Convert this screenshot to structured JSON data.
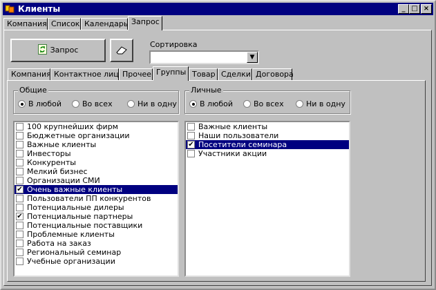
{
  "window": {
    "title": "Клиенты"
  },
  "main_tabs": [
    {
      "label": "Компания",
      "active": false
    },
    {
      "label": "Список",
      "active": false
    },
    {
      "label": "Календарь",
      "active": false
    },
    {
      "label": "Запрос",
      "active": true
    }
  ],
  "query": {
    "run_label": "Запрос",
    "sort_label": "Сортировка",
    "sort_value": ""
  },
  "sub_tabs": [
    {
      "label": "Компания",
      "active": false
    },
    {
      "label": "Контактное лицо",
      "active": false
    },
    {
      "label": "Прочее",
      "active": false
    },
    {
      "label": "Группы",
      "active": true
    },
    {
      "label": "Товар",
      "active": false
    },
    {
      "label": "Сделки",
      "active": false
    },
    {
      "label": "Договора",
      "active": false
    }
  ],
  "common": {
    "title": "Общие",
    "options": [
      "В любой",
      "Во всех",
      "Ни в одну"
    ],
    "selected": 0,
    "items": [
      {
        "label": "100 крупнейших фирм",
        "checked": false,
        "selected": false
      },
      {
        "label": "Бюджетные организации",
        "checked": false,
        "selected": false
      },
      {
        "label": "Важные клиенты",
        "checked": false,
        "selected": false
      },
      {
        "label": "Инвесторы",
        "checked": false,
        "selected": false
      },
      {
        "label": "Конкуренты",
        "checked": false,
        "selected": false
      },
      {
        "label": "Мелкий бизнес",
        "checked": false,
        "selected": false
      },
      {
        "label": "Организации СМИ",
        "checked": false,
        "selected": false
      },
      {
        "label": "Очень важные клиенты",
        "checked": true,
        "selected": true
      },
      {
        "label": "Пользователи ПП конкурентов",
        "checked": false,
        "selected": false
      },
      {
        "label": "Потенциальные дилеры",
        "checked": false,
        "selected": false
      },
      {
        "label": "Потенциальные партнеры",
        "checked": true,
        "selected": false
      },
      {
        "label": "Потенциальные поставщики",
        "checked": false,
        "selected": false
      },
      {
        "label": "Проблемные клиенты",
        "checked": false,
        "selected": false
      },
      {
        "label": "Работа на заказ",
        "checked": false,
        "selected": false
      },
      {
        "label": "Региональный семинар",
        "checked": false,
        "selected": false
      },
      {
        "label": "Учебные организации",
        "checked": false,
        "selected": false
      }
    ]
  },
  "personal": {
    "title": "Личные",
    "options": [
      "В любой",
      "Во всех",
      "Ни в одну"
    ],
    "selected": 0,
    "items": [
      {
        "label": "Важные клиенты",
        "checked": false,
        "selected": false
      },
      {
        "label": "Наши пользователи",
        "checked": false,
        "selected": false
      },
      {
        "label": "Посетители семинара",
        "checked": true,
        "selected": true
      },
      {
        "label": "Участники акции",
        "checked": false,
        "selected": false
      }
    ]
  },
  "colors": {
    "titlebar": "#000080",
    "selection": "#000080",
    "face": "#c0c0c0"
  }
}
